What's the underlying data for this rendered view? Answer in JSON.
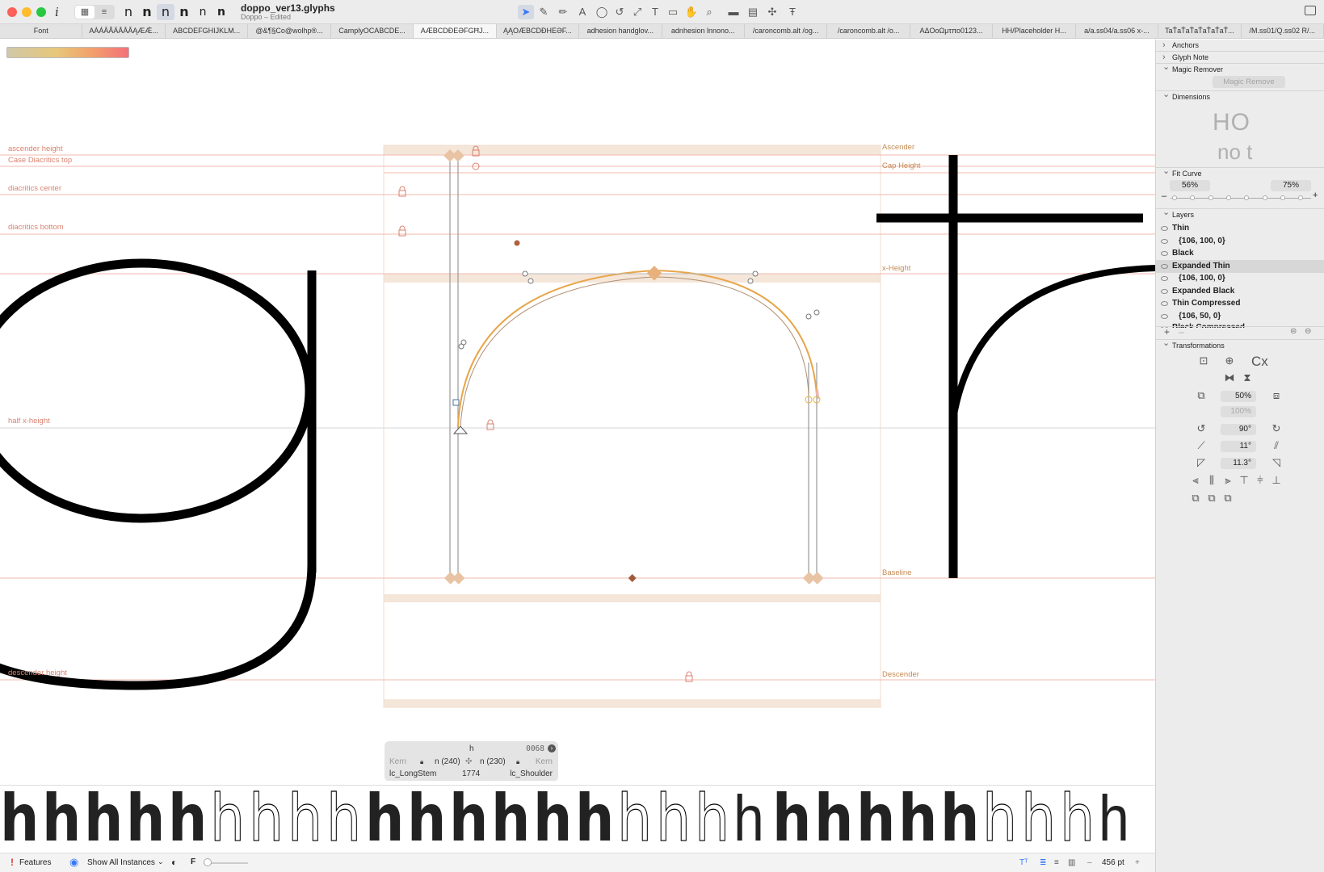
{
  "window": {
    "title": "doppo_ver13.glyphs",
    "subtitle": "Doppo – Edited"
  },
  "toolbar": {
    "info_glyph": "i",
    "layer_glyphs": [
      "n",
      "n",
      "n",
      "n",
      "n",
      "n"
    ]
  },
  "tabs": [
    {
      "label": "Font"
    },
    {
      "label": "AÀÁÂÃÄÅĀĂĄÆǼ..."
    },
    {
      "label": "ABCDEFGHIJKLM..."
    },
    {
      "label": "@&¶§Co@wolhp®..."
    },
    {
      "label": "CamplyOCABCDE..."
    },
    {
      "label": "AÆBCDÐEƏFGĦJ...",
      "active": true
    },
    {
      "label": "ĄĄΟÆBCDÐHEƏF..."
    },
    {
      "label": "adhesion handglov..."
    },
    {
      "label": "adnhesion lnnono..."
    },
    {
      "label": "/caroncomb.alt /og..."
    },
    {
      "label": "/caroncomb.alt /o..."
    },
    {
      "label": "AΔOoΩμτπο0123..."
    },
    {
      "label": "HH/Placeholder H..."
    },
    {
      "label": "a/a.ss04/a.ss06 x-..."
    },
    {
      "label": "TaŤaŤaŤaŤaŤaŤaŤ..."
    },
    {
      "label": "/M.ss01/Q.ss02 R/..."
    }
  ],
  "canvas": {
    "left_metrics": [
      {
        "label": "ascender height"
      },
      {
        "label": "Case Diacritics top"
      },
      {
        "label": "diacritics center"
      },
      {
        "label": "diacritics bottom"
      },
      {
        "label": "half x-height"
      },
      {
        "label": "descender height"
      }
    ],
    "right_metrics": [
      {
        "label": "Ascender"
      },
      {
        "label": "Cap Height"
      },
      {
        "label": "x-Height"
      },
      {
        "label": "Baseline"
      },
      {
        "label": "Descender"
      }
    ],
    "glyphs_visible": [
      "g",
      "h",
      "t"
    ]
  },
  "glyph_info": {
    "name": "h",
    "unicode": "0068",
    "left_kern": "Kern",
    "right_kern": "Kern",
    "left_sb": "n (240)",
    "right_sb": "n (230)",
    "left_group": "lc_LongStem",
    "width": "1774",
    "right_group": "lc_Shoulder"
  },
  "panel": {
    "anchors": "Anchors",
    "glyph_note": "Glyph Note",
    "magic_remover": "Magic Remover",
    "magic_remove_button": "Magic Remove",
    "dimensions": "Dimensions",
    "dim_sample_top": "HO",
    "dim_sample_bottom": "no t",
    "fit_curve": "Fit Curve",
    "fit_left": "56%",
    "fit_right": "75%",
    "layers_title": "Layers",
    "layers": [
      {
        "name": "Thin",
        "bold": true
      },
      {
        "name": "{106, 100, 0}",
        "bold": true
      },
      {
        "name": "Black",
        "bold": true
      },
      {
        "name": "Expanded Thin",
        "bold": true,
        "selected": true
      },
      {
        "name": "{106, 100, 0}",
        "bold": true
      },
      {
        "name": "Expanded Black",
        "bold": true
      },
      {
        "name": "Thin Compressed",
        "bold": true
      },
      {
        "name": "{106, 50, 0}",
        "bold": true
      },
      {
        "name": "Black Compressed",
        "bold": true
      }
    ],
    "transformations": "Transformations",
    "cx_label": "Cx",
    "scale": "50%",
    "scale_v": "100%",
    "rotate": "90°",
    "slant": "11°",
    "skew": "11.3°"
  },
  "preview": {
    "text_weights": [
      "h",
      "h",
      "h",
      "h",
      "h",
      "h",
      "h",
      "h",
      "h",
      "h",
      "h",
      "h",
      "h",
      "h",
      "h",
      "h",
      "h",
      "h",
      "h",
      "h",
      "h",
      "h",
      "h",
      "h",
      "h",
      "h",
      "h",
      "h"
    ]
  },
  "status": {
    "features": "Features",
    "show_instances": "Show All Instances",
    "f_label": "F",
    "zoom": "456 pt"
  },
  "colors": {
    "accent": "#3478f6",
    "metric_line": "#f2b8ae",
    "metric_label": "#d98270",
    "zone_fill": "#f5e6da",
    "orange_path": "#e8a64a"
  }
}
